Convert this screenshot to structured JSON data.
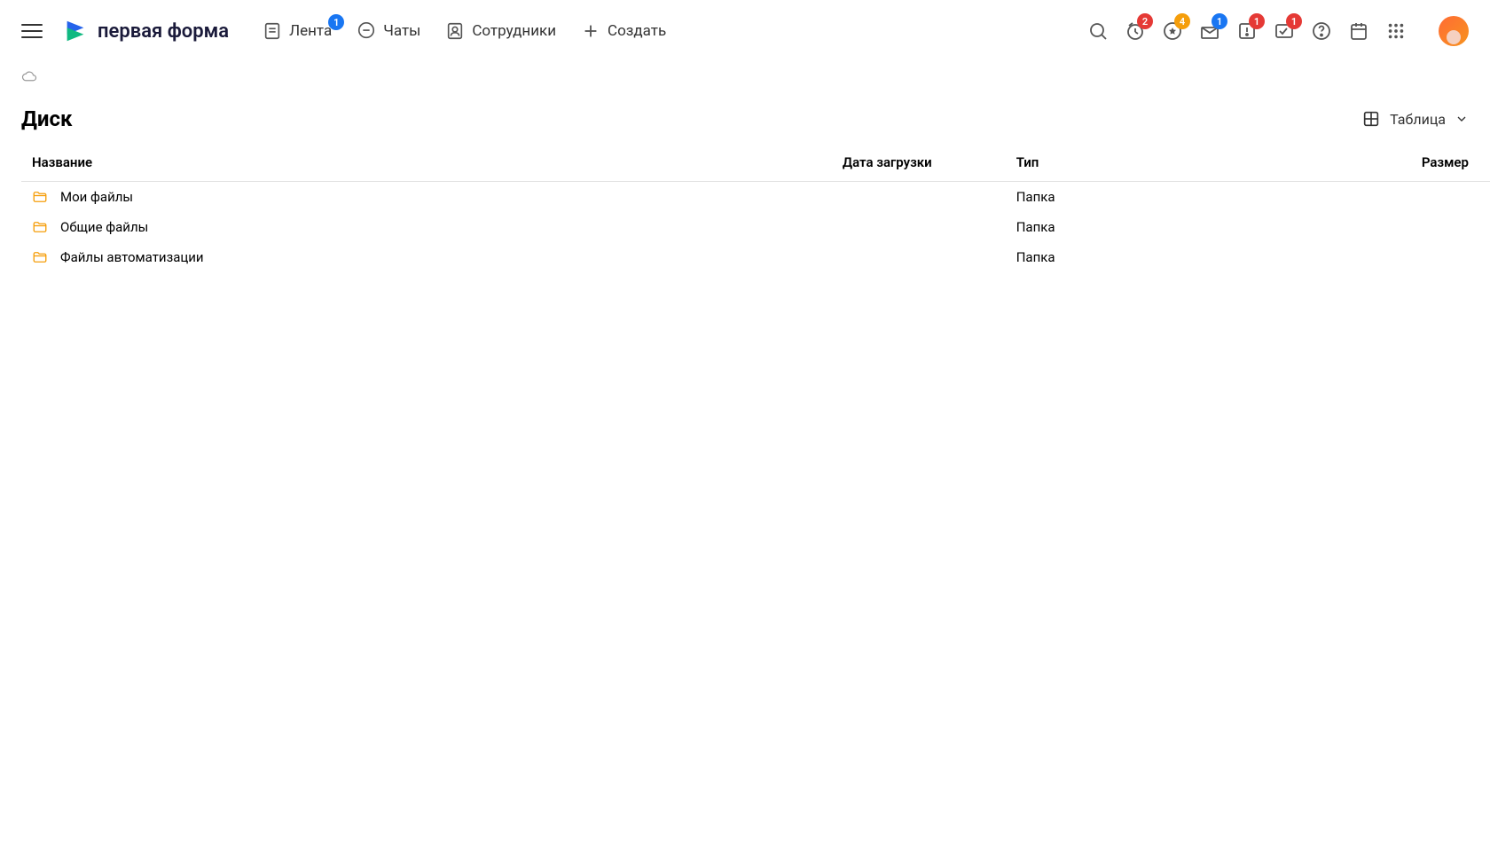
{
  "brand": {
    "name": "первая форма"
  },
  "nav": {
    "feed": {
      "label": "Лента",
      "badge": "1"
    },
    "chats": {
      "label": "Чаты"
    },
    "employees": {
      "label": "Сотрудники"
    },
    "create": {
      "label": "Создать"
    }
  },
  "header_badges": {
    "clock": "2",
    "star": "4",
    "inbox": "1",
    "alert": "1",
    "approve": "1"
  },
  "page": {
    "title": "Диск"
  },
  "view": {
    "label": "Таблица"
  },
  "table": {
    "headers": {
      "name": "Название",
      "date": "Дата загрузки",
      "type": "Тип",
      "size": "Размер"
    },
    "rows": [
      {
        "name": "Мои файлы",
        "date": "",
        "type": "Папка",
        "size": ""
      },
      {
        "name": "Общие файлы",
        "date": "",
        "type": "Папка",
        "size": ""
      },
      {
        "name": "Файлы автоматизации",
        "date": "",
        "type": "Папка",
        "size": ""
      }
    ]
  }
}
